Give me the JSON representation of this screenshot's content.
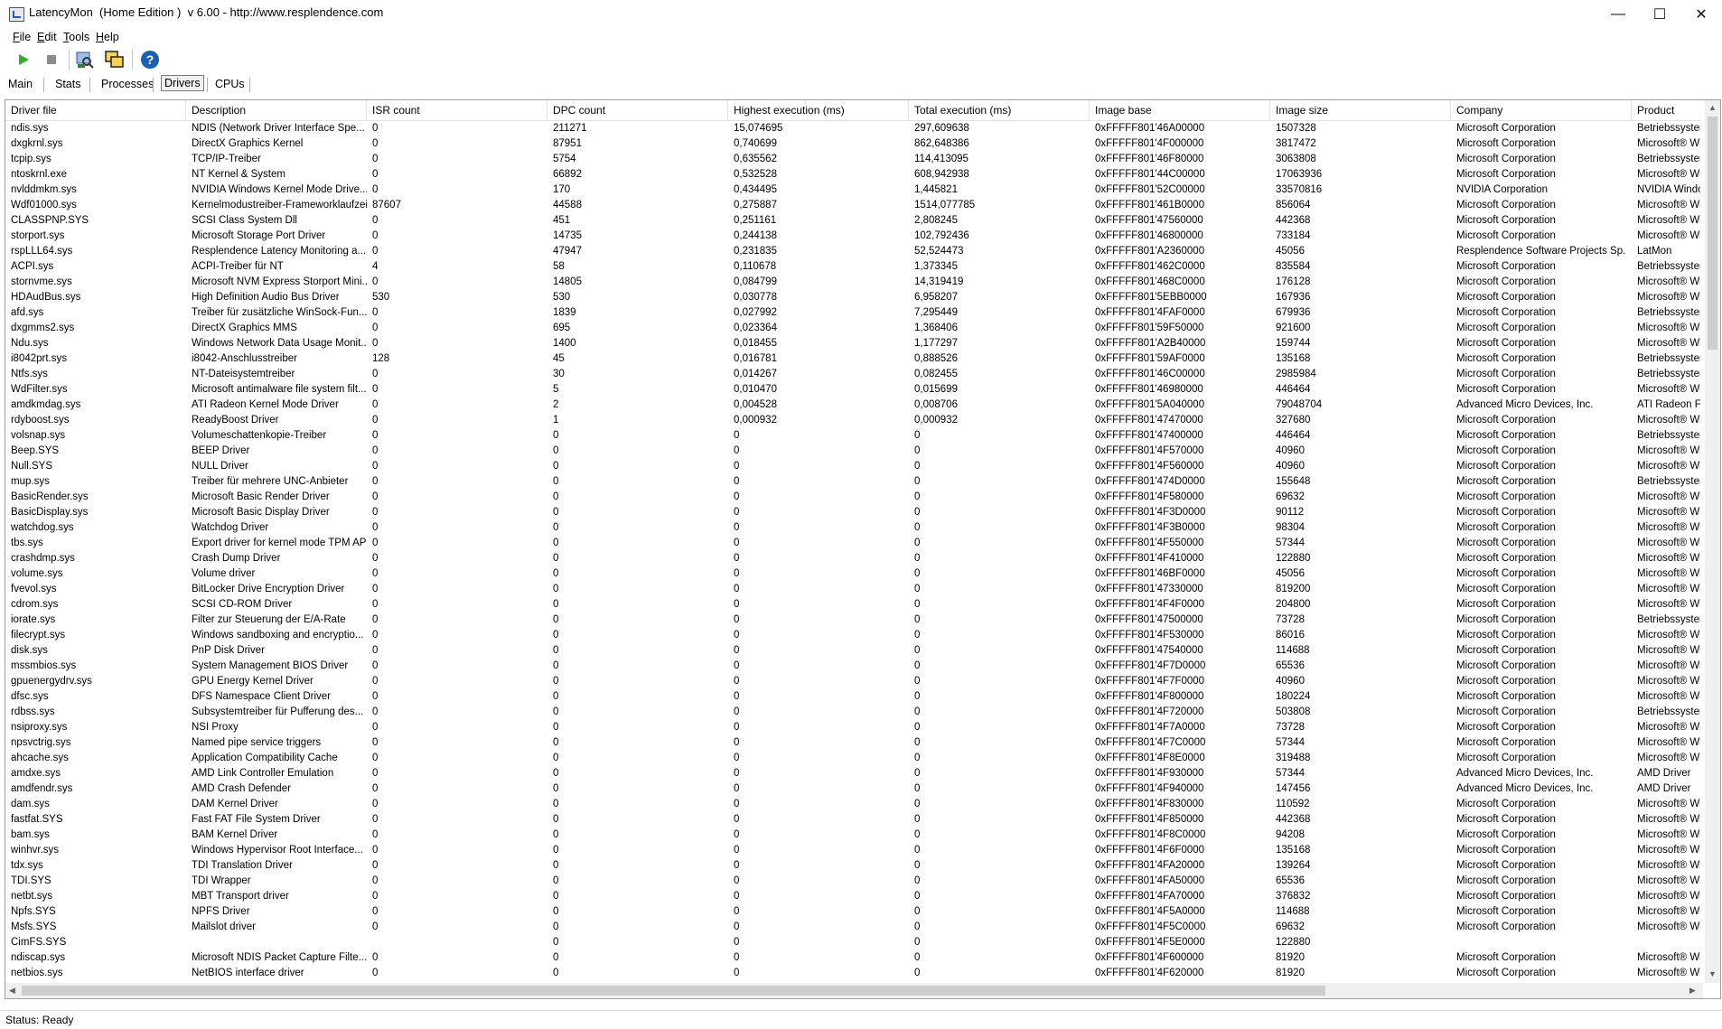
{
  "window": {
    "title": "LatencyMon  (Home Edition )  v 6.00 - http://www.resplendence.com",
    "minimize": "—",
    "maximize": "☐",
    "close": "✕"
  },
  "menu": [
    {
      "name": "file",
      "label": "File",
      "u": "F",
      "rest": "ile"
    },
    {
      "name": "edit",
      "label": "Edit",
      "u": "E",
      "rest": "dit"
    },
    {
      "name": "tools",
      "label": "Tools",
      "u": "T",
      "rest": "ools"
    },
    {
      "name": "help",
      "label": "Help",
      "u": "H",
      "rest": "elp"
    }
  ],
  "toolbar": {
    "icons": [
      "play-icon",
      "stop-icon",
      "driver-lookup-icon",
      "window-icon",
      "help-icon"
    ],
    "colors": {
      "play": "#2fae2f",
      "stop": "#8c8c8c",
      "help": "#1a5fb4"
    }
  },
  "tabs": [
    {
      "name": "tab-main",
      "label": "Main",
      "active": false
    },
    {
      "name": "tab-stats",
      "label": "Stats",
      "active": false
    },
    {
      "name": "tab-processes",
      "label": "Processes",
      "active": false
    },
    {
      "name": "tab-drivers",
      "label": "Drivers",
      "active": true
    },
    {
      "name": "tab-cpus",
      "label": "CPUs",
      "active": false
    }
  ],
  "table": {
    "columns": [
      "Driver file",
      "Description",
      "ISR count",
      "DPC count",
      "Highest execution (ms)",
      "Total execution (ms)",
      "Image base",
      "Image size",
      "Company",
      "Product"
    ],
    "rows": [
      [
        "ndis.sys",
        "NDIS (Network Driver Interface Spe...",
        "0",
        "211271",
        "15,074695",
        "297,609638",
        "0xFFFFF801'46A00000",
        "1507328",
        "Microsoft Corporation",
        "Betriebssystem"
      ],
      [
        "dxgkrnl.sys",
        "DirectX Graphics Kernel",
        "0",
        "87951",
        "0,740699",
        "862,648386",
        "0xFFFFF801'4F000000",
        "3817472",
        "Microsoft Corporation",
        "Microsoft® Wi"
      ],
      [
        "tcpip.sys",
        "TCP/IP-Treiber",
        "0",
        "5754",
        "0,635562",
        "114,413095",
        "0xFFFFF801'46F80000",
        "3063808",
        "Microsoft Corporation",
        "Betriebssystem"
      ],
      [
        "ntoskrnl.exe",
        "NT Kernel & System",
        "0",
        "66892",
        "0,532528",
        "608,942938",
        "0xFFFFF801'44C00000",
        "17063936",
        "Microsoft Corporation",
        "Microsoft® Wi"
      ],
      [
        "nvlddmkm.sys",
        "NVIDIA Windows Kernel Mode Drive...",
        "0",
        "170",
        "0,434495",
        "1,445821",
        "0xFFFFF801'52C00000",
        "33570816",
        "NVIDIA Corporation",
        "NVIDIA Windo"
      ],
      [
        "Wdf01000.sys",
        "Kernelmodustreiber-Frameworklaufzeit",
        "87607",
        "44588",
        "0,275887",
        "1514,077785",
        "0xFFFFF801'461B0000",
        "856064",
        "Microsoft Corporation",
        "Microsoft® Wi"
      ],
      [
        "CLASSPNP.SYS",
        "SCSI Class System Dll",
        "0",
        "451",
        "0,251161",
        "2,808245",
        "0xFFFFF801'47560000",
        "442368",
        "Microsoft Corporation",
        "Microsoft® Wi"
      ],
      [
        "storport.sys",
        "Microsoft Storage Port Driver",
        "0",
        "14735",
        "0,244138",
        "102,792436",
        "0xFFFFF801'46800000",
        "733184",
        "Microsoft Corporation",
        "Microsoft® Wi"
      ],
      [
        "rspLLL64.sys",
        "Resplendence Latency Monitoring a...",
        "0",
        "47947",
        "0,231835",
        "52,524473",
        "0xFFFFF801'A2360000",
        "45056",
        "Resplendence Software Projects Sp.",
        "LatMon"
      ],
      [
        "ACPI.sys",
        "ACPI-Treiber für NT",
        "4",
        "58",
        "0,110678",
        "1,373345",
        "0xFFFFF801'462C0000",
        "835584",
        "Microsoft Corporation",
        "Betriebssystem"
      ],
      [
        "stornvme.sys",
        "Microsoft NVM Express Storport Mini...",
        "0",
        "14805",
        "0,084799",
        "14,319419",
        "0xFFFFF801'468C0000",
        "176128",
        "Microsoft Corporation",
        "Microsoft® Wi"
      ],
      [
        "HDAudBus.sys",
        "High Definition Audio Bus Driver",
        "530",
        "530",
        "0,030778",
        "6,958207",
        "0xFFFFF801'5EBB0000",
        "167936",
        "Microsoft Corporation",
        "Microsoft® Wi"
      ],
      [
        "afd.sys",
        "Treiber für zusätzliche WinSock-Fun...",
        "0",
        "1839",
        "0,027992",
        "7,295449",
        "0xFFFFF801'4FAF0000",
        "679936",
        "Microsoft Corporation",
        "Betriebssystem"
      ],
      [
        "dxgmms2.sys",
        "DirectX Graphics MMS",
        "0",
        "695",
        "0,023364",
        "1,368406",
        "0xFFFFF801'59F50000",
        "921600",
        "Microsoft Corporation",
        "Microsoft® Wi"
      ],
      [
        "Ndu.sys",
        "Windows Network Data Usage Monit...",
        "0",
        "1400",
        "0,018455",
        "1,177297",
        "0xFFFFF801'A2B40000",
        "159744",
        "Microsoft Corporation",
        "Microsoft® Wi"
      ],
      [
        "i8042prt.sys",
        "i8042-Anschlusstreiber",
        "128",
        "45",
        "0,016781",
        "0,888526",
        "0xFFFFF801'59AF0000",
        "135168",
        "Microsoft Corporation",
        "Betriebssystem"
      ],
      [
        "Ntfs.sys",
        "NT-Dateisystemtreiber",
        "0",
        "30",
        "0,014267",
        "0,082455",
        "0xFFFFF801'46C00000",
        "2985984",
        "Microsoft Corporation",
        "Betriebssystem"
      ],
      [
        "WdFilter.sys",
        "Microsoft antimalware file system filt...",
        "0",
        "5",
        "0,010470",
        "0,015699",
        "0xFFFFF801'46980000",
        "446464",
        "Microsoft Corporation",
        "Microsoft® Wi"
      ],
      [
        "amdkmdag.sys",
        "ATI Radeon Kernel Mode Driver",
        "0",
        "2",
        "0,004528",
        "0,008706",
        "0xFFFFF801'5A040000",
        "79048704",
        "Advanced Micro Devices, Inc.",
        "ATI Radeon Fa"
      ],
      [
        "rdyboost.sys",
        "ReadyBoost Driver",
        "0",
        "1",
        "0,000932",
        "0,000932",
        "0xFFFFF801'47470000",
        "327680",
        "Microsoft Corporation",
        "Microsoft® Wi"
      ],
      [
        "volsnap.sys",
        "Volumeschattenkopie-Treiber",
        "0",
        "0",
        "0",
        "0",
        "0xFFFFF801'47400000",
        "446464",
        "Microsoft Corporation",
        "Betriebssystem"
      ],
      [
        "Beep.SYS",
        "BEEP Driver",
        "0",
        "0",
        "0",
        "0",
        "0xFFFFF801'4F570000",
        "40960",
        "Microsoft Corporation",
        "Microsoft® Wi"
      ],
      [
        "Null.SYS",
        "NULL Driver",
        "0",
        "0",
        "0",
        "0",
        "0xFFFFF801'4F560000",
        "40960",
        "Microsoft Corporation",
        "Microsoft® Wi"
      ],
      [
        "mup.sys",
        "Treiber für mehrere UNC-Anbieter",
        "0",
        "0",
        "0",
        "0",
        "0xFFFFF801'474D0000",
        "155648",
        "Microsoft Corporation",
        "Betriebssystem"
      ],
      [
        "BasicRender.sys",
        "Microsoft Basic Render Driver",
        "0",
        "0",
        "0",
        "0",
        "0xFFFFF801'4F580000",
        "69632",
        "Microsoft Corporation",
        "Microsoft® Wi"
      ],
      [
        "BasicDisplay.sys",
        "Microsoft Basic Display Driver",
        "0",
        "0",
        "0",
        "0",
        "0xFFFFF801'4F3D0000",
        "90112",
        "Microsoft Corporation",
        "Microsoft® Wi"
      ],
      [
        "watchdog.sys",
        "Watchdog Driver",
        "0",
        "0",
        "0",
        "0",
        "0xFFFFF801'4F3B0000",
        "98304",
        "Microsoft Corporation",
        "Microsoft® Wi"
      ],
      [
        "tbs.sys",
        "Export driver for kernel mode TPM API",
        "0",
        "0",
        "0",
        "0",
        "0xFFFFF801'4F550000",
        "57344",
        "Microsoft Corporation",
        "Microsoft® Wi"
      ],
      [
        "crashdmp.sys",
        "Crash Dump Driver",
        "0",
        "0",
        "0",
        "0",
        "0xFFFFF801'4F410000",
        "122880",
        "Microsoft Corporation",
        "Microsoft® Wi"
      ],
      [
        "volume.sys",
        "Volume driver",
        "0",
        "0",
        "0",
        "0",
        "0xFFFFF801'46BF0000",
        "45056",
        "Microsoft Corporation",
        "Microsoft® Wi"
      ],
      [
        "fvevol.sys",
        "BitLocker Drive Encryption Driver",
        "0",
        "0",
        "0",
        "0",
        "0xFFFFF801'47330000",
        "819200",
        "Microsoft Corporation",
        "Microsoft® Wi"
      ],
      [
        "cdrom.sys",
        "SCSI CD-ROM Driver",
        "0",
        "0",
        "0",
        "0",
        "0xFFFFF801'4F4F0000",
        "204800",
        "Microsoft Corporation",
        "Microsoft® Wi"
      ],
      [
        "iorate.sys",
        "Filter zur Steuerung der E/A-Rate",
        "0",
        "0",
        "0",
        "0",
        "0xFFFFF801'47500000",
        "73728",
        "Microsoft Corporation",
        "Betriebssystem"
      ],
      [
        "filecrypt.sys",
        "Windows sandboxing and encryptio...",
        "0",
        "0",
        "0",
        "0",
        "0xFFFFF801'4F530000",
        "86016",
        "Microsoft Corporation",
        "Microsoft® Wi"
      ],
      [
        "disk.sys",
        "PnP Disk Driver",
        "0",
        "0",
        "0",
        "0",
        "0xFFFFF801'47540000",
        "114688",
        "Microsoft Corporation",
        "Microsoft® Wi"
      ],
      [
        "mssmbios.sys",
        "System Management BIOS Driver",
        "0",
        "0",
        "0",
        "0",
        "0xFFFFF801'4F7D0000",
        "65536",
        "Microsoft Corporation",
        "Microsoft® Wi"
      ],
      [
        "gpuenergydrv.sys",
        "GPU Energy Kernel Driver",
        "0",
        "0",
        "0",
        "0",
        "0xFFFFF801'4F7F0000",
        "40960",
        "Microsoft Corporation",
        "Microsoft® Wi"
      ],
      [
        "dfsc.sys",
        "DFS Namespace Client Driver",
        "0",
        "0",
        "0",
        "0",
        "0xFFFFF801'4F800000",
        "180224",
        "Microsoft Corporation",
        "Microsoft® Wi"
      ],
      [
        "rdbss.sys",
        "Subsystemtreiber für Pufferung des...",
        "0",
        "0",
        "0",
        "0",
        "0xFFFFF801'4F720000",
        "503808",
        "Microsoft Corporation",
        "Betriebssystem"
      ],
      [
        "nsiproxy.sys",
        "NSI Proxy",
        "0",
        "0",
        "0",
        "0",
        "0xFFFFF801'4F7A0000",
        "73728",
        "Microsoft Corporation",
        "Microsoft® Wi"
      ],
      [
        "npsvctrig.sys",
        "Named pipe service triggers",
        "0",
        "0",
        "0",
        "0",
        "0xFFFFF801'4F7C0000",
        "57344",
        "Microsoft Corporation",
        "Microsoft® Wi"
      ],
      [
        "ahcache.sys",
        "Application Compatibility Cache",
        "0",
        "0",
        "0",
        "0",
        "0xFFFFF801'4F8E0000",
        "319488",
        "Microsoft Corporation",
        "Microsoft® Wi"
      ],
      [
        "amdxe.sys",
        "AMD Link Controller Emulation",
        "0",
        "0",
        "0",
        "0",
        "0xFFFFF801'4F930000",
        "57344",
        "Advanced Micro Devices, Inc.",
        "AMD Driver"
      ],
      [
        "amdfendr.sys",
        "AMD Crash Defender",
        "0",
        "0",
        "0",
        "0",
        "0xFFFFF801'4F940000",
        "147456",
        "Advanced Micro Devices, Inc.",
        "AMD Driver"
      ],
      [
        "dam.sys",
        "DAM Kernel Driver",
        "0",
        "0",
        "0",
        "0",
        "0xFFFFF801'4F830000",
        "110592",
        "Microsoft Corporation",
        "Microsoft® Wi"
      ],
      [
        "fastfat.SYS",
        "Fast FAT File System Driver",
        "0",
        "0",
        "0",
        "0",
        "0xFFFFF801'4F850000",
        "442368",
        "Microsoft Corporation",
        "Microsoft® Wi"
      ],
      [
        "bam.sys",
        "BAM Kernel Driver",
        "0",
        "0",
        "0",
        "0",
        "0xFFFFF801'4F8C0000",
        "94208",
        "Microsoft Corporation",
        "Microsoft® Wi"
      ],
      [
        "winhvr.sys",
        "Windows Hypervisor Root Interface...",
        "0",
        "0",
        "0",
        "0",
        "0xFFFFF801'4F6F0000",
        "135168",
        "Microsoft Corporation",
        "Microsoft® Wi"
      ],
      [
        "tdx.sys",
        "TDI Translation Driver",
        "0",
        "0",
        "0",
        "0",
        "0xFFFFF801'4FA20000",
        "139264",
        "Microsoft Corporation",
        "Microsoft® Wi"
      ],
      [
        "TDI.SYS",
        "TDI Wrapper",
        "0",
        "0",
        "0",
        "0",
        "0xFFFFF801'4FA50000",
        "65536",
        "Microsoft Corporation",
        "Microsoft® Wi"
      ],
      [
        "netbt.sys",
        "MBT Transport driver",
        "0",
        "0",
        "0",
        "0",
        "0xFFFFF801'4FA70000",
        "376832",
        "Microsoft Corporation",
        "Microsoft® Wi"
      ],
      [
        "Npfs.SYS",
        "NPFS Driver",
        "0",
        "0",
        "0",
        "0",
        "0xFFFFF801'4F5A0000",
        "114688",
        "Microsoft Corporation",
        "Microsoft® Wi"
      ],
      [
        "Msfs.SYS",
        "Mailslot driver",
        "0",
        "0",
        "0",
        "0",
        "0xFFFFF801'4F5C0000",
        "69632",
        "Microsoft Corporation",
        "Microsoft® Wi"
      ],
      [
        "CimFS.SYS",
        "",
        "",
        "0",
        "0",
        "0",
        "0xFFFFF801'4F5E0000",
        "122880",
        "",
        ""
      ],
      [
        "ndiscap.sys",
        "Microsoft NDIS Packet Capture Filte...",
        "0",
        "0",
        "0",
        "0",
        "0xFFFFF801'4F600000",
        "81920",
        "Microsoft Corporation",
        "Microsoft® Wi"
      ],
      [
        "netbios.sys",
        "NetBIOS interface driver",
        "0",
        "0",
        "0",
        "0",
        "0xFFFFF801'4F620000",
        "81920",
        "Microsoft Corporation",
        "Microsoft® Wi"
      ]
    ]
  },
  "status": {
    "text": "Status: Ready"
  }
}
